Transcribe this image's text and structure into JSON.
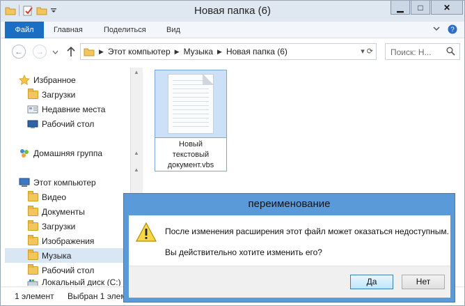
{
  "window": {
    "title": "Новая папка (6)",
    "caption_minimize": "▁",
    "caption_maximize": "□",
    "caption_close": "✕"
  },
  "ribbon": {
    "tabs": [
      "Файл",
      "Главная",
      "Поделиться",
      "Вид"
    ],
    "expand_icon": "chevron-down",
    "help_icon": "question-mark"
  },
  "address": {
    "crumbs": [
      "Этот компьютер",
      "Музыка",
      "Новая папка (6)"
    ],
    "search_placeholder": "Поиск: Н..."
  },
  "nav": {
    "items": [
      {
        "label": "Избранное",
        "icon": "star-icon"
      },
      {
        "label": "Загрузки",
        "icon": "downloads-folder-icon"
      },
      {
        "label": "Недавние места",
        "icon": "recent-places-icon"
      },
      {
        "label": "Рабочий стол",
        "icon": "desktop-icon"
      },
      {
        "label": "Домашняя группа",
        "icon": "homegroup-icon"
      },
      {
        "label": "Этот компьютер",
        "icon": "computer-icon"
      },
      {
        "label": "Видео",
        "icon": "folder-icon"
      },
      {
        "label": "Документы",
        "icon": "folder-icon"
      },
      {
        "label": "Загрузки",
        "icon": "downloads-folder-icon"
      },
      {
        "label": "Изображения",
        "icon": "folder-icon"
      },
      {
        "label": "Музыка",
        "icon": "music-folder-icon"
      },
      {
        "label": "Рабочий стол",
        "icon": "folder-icon"
      },
      {
        "label": "Локальный диск (C:)",
        "icon": "drive-icon"
      }
    ]
  },
  "file": {
    "name_lines": [
      "Новый",
      "текстовый",
      "документ.vbs"
    ],
    "icon": "text-document-icon"
  },
  "status": {
    "count": "1 элемент",
    "selected": "Выбран 1 элем"
  },
  "dialog": {
    "title": "переименование",
    "message": "После изменения расширения этот файл может оказаться недоступным.",
    "question": "Вы действительно хотите изменить его?",
    "yes": "Да",
    "no": "Нет",
    "icon": "warning-icon"
  }
}
